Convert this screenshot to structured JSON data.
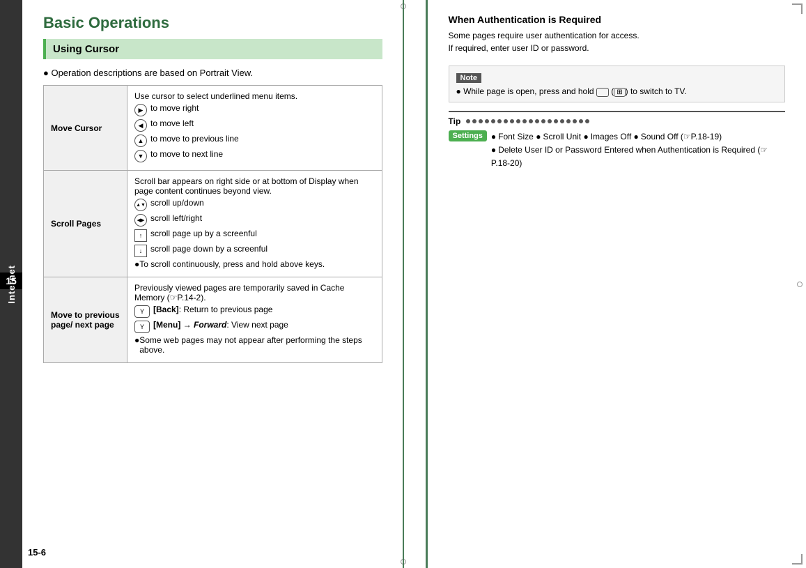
{
  "page": {
    "number": "15-6",
    "chapter": "15"
  },
  "sidebar": {
    "label": "Internet",
    "chapter_number": "15"
  },
  "main": {
    "title": "Basic Operations",
    "section_title": "Using Cursor",
    "intro_bullet": "Operation descriptions are based on Portrait View.",
    "table": {
      "rows": [
        {
          "label": "Move Cursor",
          "description_lines": [
            {
              "type": "text",
              "text": "Use cursor to select underlined menu items."
            },
            {
              "type": "icon_text",
              "icon": "▶",
              "icon_type": "circle",
              "text": "to move right"
            },
            {
              "type": "icon_text",
              "icon": "◀",
              "icon_type": "circle",
              "text": "to move left"
            },
            {
              "type": "icon_text",
              "icon": "▲",
              "icon_type": "circle",
              "text": "to move to previous line"
            },
            {
              "type": "icon_text",
              "icon": "▼",
              "icon_type": "circle",
              "text": "to move to next line"
            }
          ]
        },
        {
          "label": "Scroll Pages",
          "description_lines": [
            {
              "type": "text",
              "text": "Scroll bar appears on right side or at bottom of Display when page content continues beyond view."
            },
            {
              "type": "icon_text",
              "icon": "▲▼",
              "icon_type": "circle",
              "text": "scroll up/down"
            },
            {
              "type": "icon_text",
              "icon": "◀▶",
              "icon_type": "circle",
              "text": "scroll left/right"
            },
            {
              "type": "icon_text",
              "icon": "↑",
              "icon_type": "square",
              "text": "scroll page up by a screenful"
            },
            {
              "type": "icon_text",
              "icon": "↓",
              "icon_type": "square",
              "text": "scroll page down by a screenful"
            },
            {
              "type": "bullet",
              "text": "To scroll continuously, press and hold above keys."
            }
          ]
        },
        {
          "label": "Move to previous page/ next page",
          "description_lines": [
            {
              "type": "text",
              "text": "Previously viewed pages are temporarily saved in Cache Memory (☞P.14-2)."
            },
            {
              "type": "icon_text",
              "icon": "Y",
              "icon_type": "rounded",
              "text": "[Back]: Return to previous page"
            },
            {
              "type": "icon_text_bold",
              "icon": "Y",
              "icon_type": "rounded",
              "text": "[Menu] → Forward: View next page"
            },
            {
              "type": "bullet",
              "text": "Some web pages may not appear after performing the steps above."
            }
          ]
        }
      ]
    }
  },
  "right": {
    "auth_section": {
      "title": "When Authentication is Required",
      "lines": [
        "Some pages require user authentication for access.",
        "If required, enter user ID or password."
      ]
    },
    "note": {
      "label": "Note",
      "content": "While page is open, press and hold  (  )  to switch to TV."
    },
    "tip": {
      "label": "Tip",
      "dots_count": 20
    },
    "settings": {
      "label": "Settings",
      "items": [
        "Font Size ●Scroll Unit ●Images Off ●Sound Off (☞P.18-19)",
        "Delete User ID or Password Entered when Authentication is Required (☞P.18-20)"
      ]
    }
  }
}
